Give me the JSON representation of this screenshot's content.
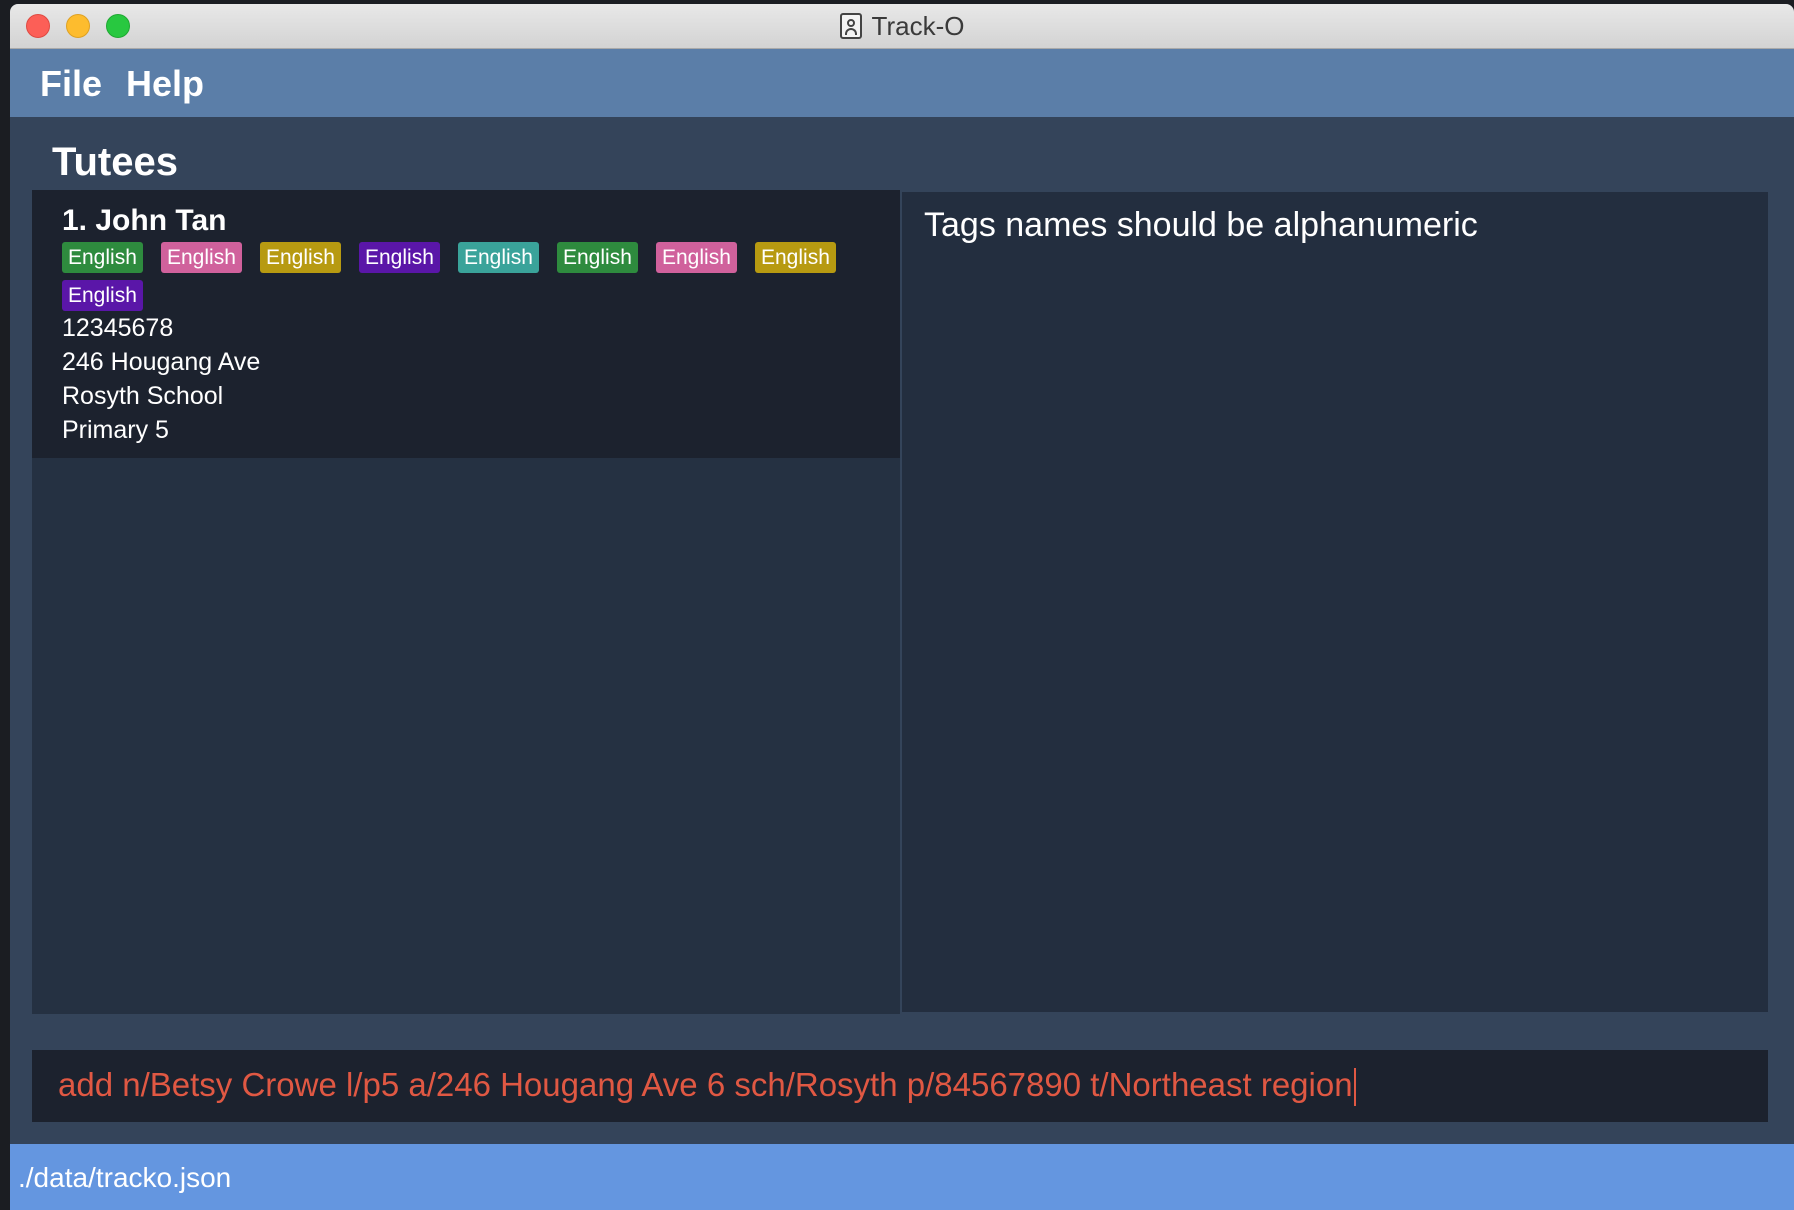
{
  "window": {
    "title": "Track-O"
  },
  "menu": {
    "file": "File",
    "help": "Help"
  },
  "section": {
    "title": "Tutees"
  },
  "tutees": [
    {
      "index": "1.",
      "name": "John Tan",
      "display_name": "1.  John Tan",
      "tags": [
        {
          "label": "English",
          "color": "#2e8b3e"
        },
        {
          "label": "English",
          "color": "#d0619c"
        },
        {
          "label": "English",
          "color": "#b79a11"
        },
        {
          "label": "English",
          "color": "#5a16a8"
        },
        {
          "label": "English",
          "color": "#3aa39a"
        },
        {
          "label": "English",
          "color": "#2e8b3e"
        },
        {
          "label": "English",
          "color": "#d0619c"
        },
        {
          "label": "English",
          "color": "#b79a11"
        },
        {
          "label": "English",
          "color": "#5a16a8"
        }
      ],
      "phone": "12345678",
      "address": "246 Hougang Ave",
      "school": "Rosyth School",
      "level": "Primary 5"
    }
  ],
  "result": {
    "message": "Tags names should be alphanumeric"
  },
  "command": {
    "value": "add n/Betsy Crowe l/p5 a/246 Hougang Ave 6 sch/Rosyth p/84567890 t/Northeast region"
  },
  "status": {
    "path": "./data/tracko.json"
  },
  "colors": {
    "menubar": "#5b7ea8",
    "background": "#34445a",
    "command_text": "#e05843",
    "status_bar": "#6496e0"
  }
}
